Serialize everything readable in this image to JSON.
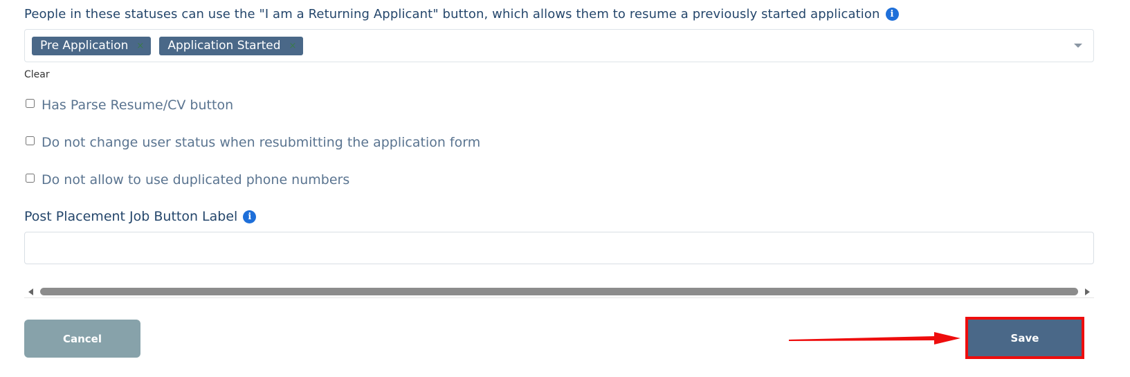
{
  "returning_applicant": {
    "label": "People in these statuses can use the \"I am a Returning Applicant\" button, which allows them to resume a previously started application",
    "info_icon": "info-icon",
    "selected_tags": [
      {
        "label": "Pre Application",
        "remove": "×"
      },
      {
        "label": "Application Started",
        "remove": "×"
      }
    ],
    "dropdown_icon": "chevron-down-icon",
    "clear_label": "Clear"
  },
  "options": [
    {
      "label": "Has Parse Resume/CV button",
      "checked": false
    },
    {
      "label": "Do not change user status when resubmitting the application form",
      "checked": false
    },
    {
      "label": "Do not allow to use duplicated phone numbers",
      "checked": false
    }
  ],
  "post_placement": {
    "label": "Post Placement Job Button Label",
    "info_icon": "info-icon",
    "value": ""
  },
  "scrollbar": {
    "left_icon": "arrow-left-icon",
    "right_icon": "arrow-right-icon"
  },
  "actions": {
    "cancel_label": "Cancel",
    "save_label": "Save"
  },
  "annotation": {
    "highlight_color": "#ee0d0d",
    "arrow_icon": "red-arrow-icon"
  },
  "colors": {
    "tag_bg": "#4a6888",
    "save_bg": "#4a6888",
    "cancel_bg": "#87a2aa",
    "info_blue": "#1e6fd9",
    "label_text": "#24466b"
  }
}
